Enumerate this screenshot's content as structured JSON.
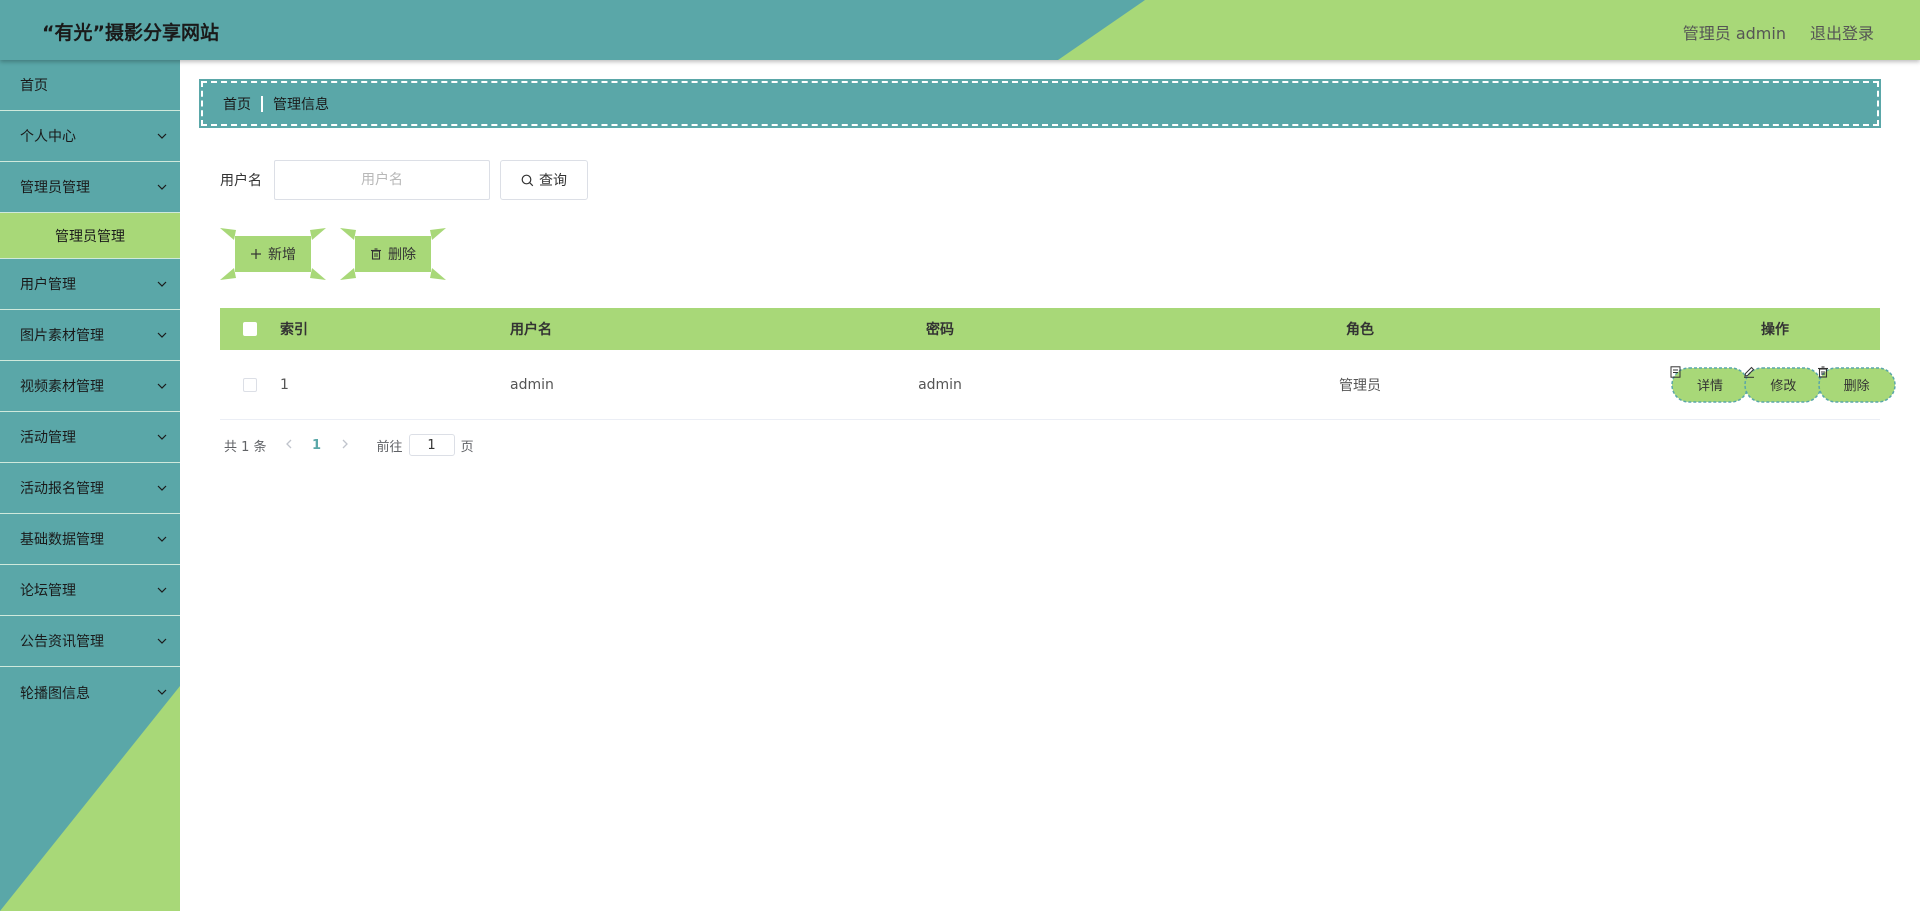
{
  "header": {
    "site_title": "“有光”摄影分享网站",
    "user_label": "管理员 admin",
    "logout_label": "退出登录"
  },
  "sidebar": {
    "items": [
      {
        "label": "首页"
      },
      {
        "label": "个人中心"
      },
      {
        "label": "管理员管理"
      },
      {
        "label": "管理员管理"
      },
      {
        "label": "用户管理"
      },
      {
        "label": "图片素材管理"
      },
      {
        "label": "视频素材管理"
      },
      {
        "label": "活动管理"
      },
      {
        "label": "活动报名管理"
      },
      {
        "label": "基础数据管理"
      },
      {
        "label": "论坛管理"
      },
      {
        "label": "公告资讯管理"
      },
      {
        "label": "轮播图信息"
      }
    ]
  },
  "breadcrumb": {
    "home": "首页",
    "current": "管理信息"
  },
  "search": {
    "label": "用户名",
    "placeholder": "用户名",
    "value": "",
    "query_label": "查询"
  },
  "actions": {
    "add_label": "新增",
    "delete_label": "删除"
  },
  "table": {
    "columns": [
      "索引",
      "用户名",
      "密码",
      "角色",
      "操作"
    ],
    "rows": [
      {
        "index": "1",
        "username": "admin",
        "password": "admin",
        "role": "管理员"
      }
    ],
    "row_actions": {
      "detail": "详情",
      "edit": "修改",
      "delete": "删除"
    }
  },
  "pagination": {
    "total": "共 1 条",
    "page": "1",
    "goto_label": "前往",
    "goto_value": "1",
    "page_suffix": "页"
  },
  "colors": {
    "primary": "#5aa7a8",
    "accent": "#a8d878"
  }
}
